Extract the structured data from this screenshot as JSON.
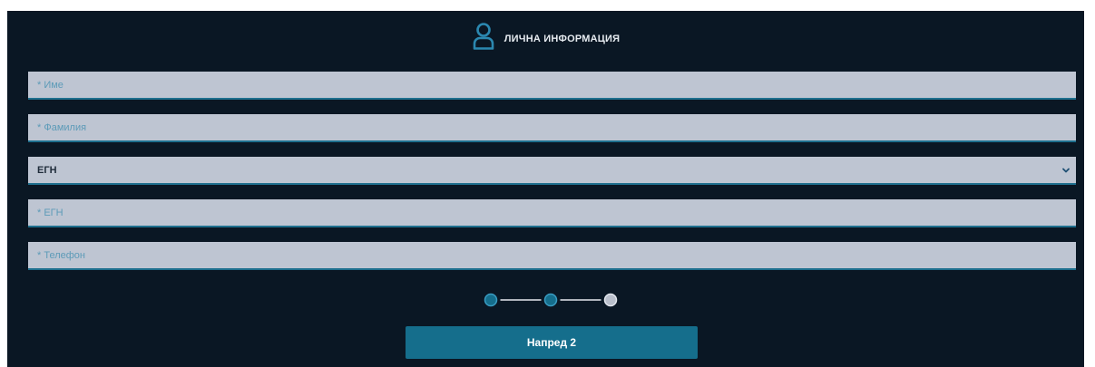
{
  "header": {
    "title": "ЛИЧНА ИНФОРМАЦИЯ",
    "icon": "user-icon"
  },
  "form": {
    "first_name": {
      "placeholder": "* Име",
      "value": ""
    },
    "last_name": {
      "placeholder": "* Фамилия",
      "value": ""
    },
    "id_type": {
      "selected": "ЕГН"
    },
    "id_number": {
      "placeholder": "* ЕГН",
      "value": ""
    },
    "phone": {
      "placeholder": "* Телефон",
      "value": ""
    }
  },
  "stepper": {
    "total_steps": 3,
    "completed_steps": 2
  },
  "next_button": {
    "label": "Напред 2"
  },
  "colors": {
    "background": "#0a1724",
    "field_background": "#bec5d2",
    "accent": "#156e8c",
    "placeholder": "#5d9bb8",
    "inactive_step": "#b9bfcb"
  }
}
